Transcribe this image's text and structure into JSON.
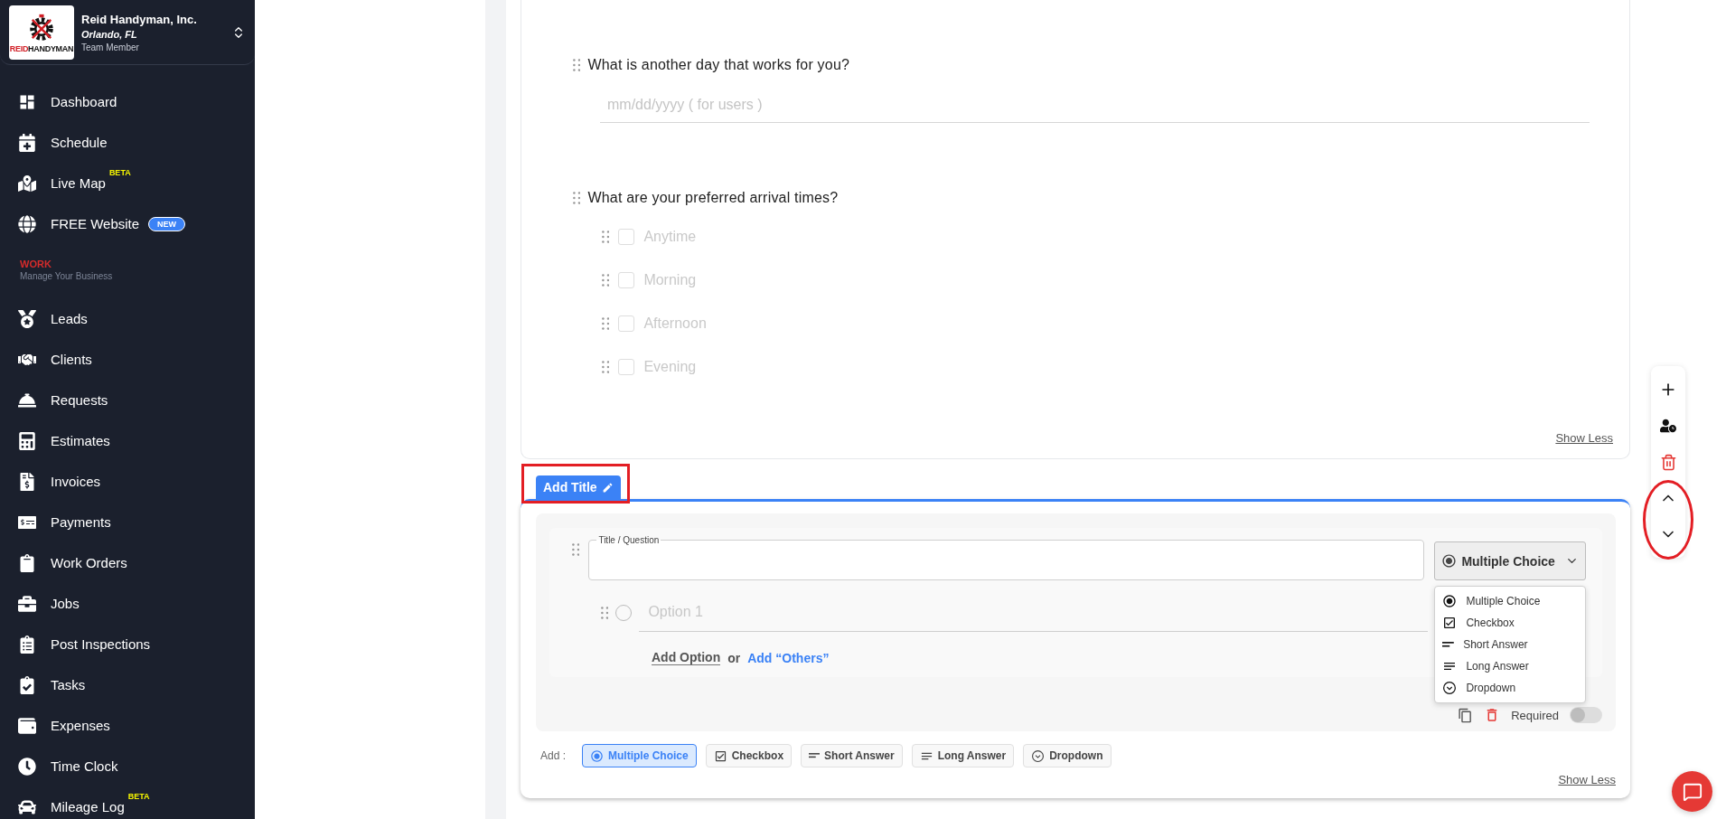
{
  "sidebar": {
    "account": {
      "name": "Reid Handyman, Inc.",
      "location": "Orlando, FL",
      "role": "Team Member",
      "logo_word_1": "REID",
      "logo_word_2": "HANDYMAN"
    },
    "groups": [
      {
        "items": [
          {
            "label": "Dashboard"
          },
          {
            "label": "Schedule"
          },
          {
            "label": "Live Map",
            "badge": {
              "kind": "tag",
              "text": "BETA"
            }
          },
          {
            "label": "FREE Website",
            "badge": {
              "kind": "pill",
              "text": "NEW"
            }
          }
        ]
      },
      {
        "heading": "WORK",
        "subheading": "Manage Your Business",
        "items": [
          {
            "label": "Leads"
          },
          {
            "label": "Clients"
          },
          {
            "label": "Requests"
          },
          {
            "label": "Estimates"
          },
          {
            "label": "Invoices"
          },
          {
            "label": "Payments"
          },
          {
            "label": "Work Orders"
          },
          {
            "label": "Jobs"
          },
          {
            "label": "Post Inspections"
          },
          {
            "label": "Tasks"
          },
          {
            "label": "Expenses"
          },
          {
            "label": "Time Clock"
          },
          {
            "label": "Mileage Log",
            "badge": {
              "kind": "tag",
              "text": "BETA"
            }
          }
        ]
      }
    ]
  },
  "form": {
    "questions": [
      {
        "kind": "date",
        "title": "What is another day that works for you?",
        "placeholder": "mm/dd/yyyy ( for users )"
      },
      {
        "kind": "checkboxes",
        "title": "What are your preferred arrival times?",
        "options": [
          {
            "label": "Anytime",
            "checked": false
          },
          {
            "label": "Morning",
            "checked": false
          },
          {
            "label": "Afternoon",
            "checked": false
          },
          {
            "label": "Evening",
            "checked": false
          }
        ]
      }
    ],
    "show_less": "Show Less"
  },
  "editor": {
    "tab": "Add Title",
    "field": {
      "label": "Title / Question"
    },
    "type_select": {
      "value": "Multiple Choice",
      "kind": "multiple_choice",
      "expanded": true
    },
    "type_menu": [
      {
        "kind": "multiple_choice",
        "label": "Multiple Choice"
      },
      {
        "kind": "checkbox",
        "label": "Checkbox"
      },
      {
        "kind": "short_answer",
        "label": "Short Answer"
      },
      {
        "kind": "long_answer",
        "label": "Long Answer"
      },
      {
        "kind": "dropdown",
        "label": "Dropdown"
      }
    ],
    "options": [
      {
        "placeholder": "Option 1",
        "selected": false
      }
    ],
    "add_option": "Add Option",
    "or": "or",
    "add_others": "Add “Others”",
    "required": {
      "label": "Required",
      "on": false
    },
    "add_label": "Add :",
    "add_types": [
      {
        "kind": "multiple_choice",
        "label": "Multiple Choice",
        "selected": true
      },
      {
        "kind": "checkbox",
        "label": "Checkbox",
        "selected": false
      },
      {
        "kind": "short_answer",
        "label": "Short Answer",
        "selected": false
      },
      {
        "kind": "long_answer",
        "label": "Long Answer",
        "selected": false
      },
      {
        "kind": "dropdown",
        "label": "Dropdown",
        "selected": false
      }
    ],
    "show_less": "Show Less"
  }
}
